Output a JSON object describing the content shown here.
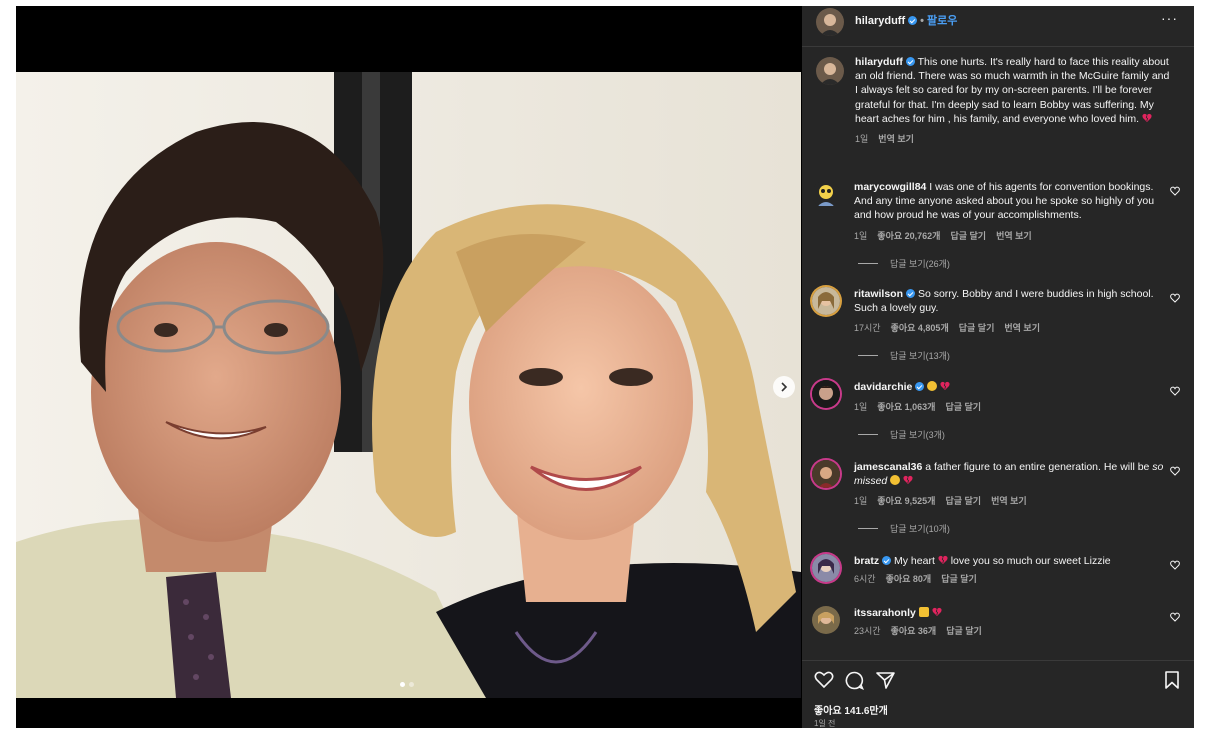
{
  "post": {
    "username": "hilaryduff",
    "follow_label": "팔로우",
    "more_label": "···",
    "caption": "This one hurts. It's really hard to face this reality about an old friend. There was so much warmth in the McGuire family and I always felt so cared for by my on-screen parents. I'll be forever grateful for that. I'm deeply sad to learn Bobby was suffering. My heart aches for him , his family, and everyone who loved him.",
    "caption_time": "1일",
    "caption_translate": "번역 보기"
  },
  "comments": [
    {
      "username": "marycowgill84",
      "text": "I was one of his agents for convention bookings. And any time anyone asked about you he spoke so highly of you and how proud he was of your accomplishments.",
      "time": "1일",
      "likes": "좋아요 20,762개",
      "reply": "답글 달기",
      "translate": "번역 보기",
      "view_replies": "답글 보기(26개)"
    },
    {
      "username": "ritawilson",
      "text": "So sorry. Bobby and I were buddies in high school. Such a lovely guy.",
      "time": "17시간",
      "likes": "좋아요 4,805개",
      "reply": "답글 달기",
      "translate": "번역 보기",
      "view_replies": "답글 보기(13개)"
    },
    {
      "username": "davidarchie",
      "text": "",
      "time": "1일",
      "likes": "좋아요 1,063개",
      "reply": "답글 달기",
      "view_replies": "답글 보기(3개)"
    },
    {
      "username": "jamescanal36",
      "text": "a father figure to an entire generation. He will be",
      "text_italic": "so missed",
      "time": "1일",
      "likes": "좋아요 9,525개",
      "reply": "답글 달기",
      "translate": "번역 보기",
      "view_replies": "답글 보기(10개)"
    },
    {
      "username": "bratz",
      "text_a": "My heart",
      "text_b": "love you so much our sweet Lizzie",
      "time": "6시간",
      "likes": "좋아요 80개",
      "reply": "답글 달기"
    },
    {
      "username": "itssarahonly",
      "time": "23시간",
      "likes": "좋아요 36개",
      "reply": "답글 달기"
    }
  ],
  "footer": {
    "likes": "좋아요 141.6만개",
    "time_ago": "1일 전"
  },
  "colors": {
    "panel_bg": "#262626",
    "link_blue": "#4a9ff5",
    "verified_blue": "#3897f0",
    "muted": "#a8a8a8",
    "broken_heart": "#e0245e"
  },
  "icons": [
    "verified-icon",
    "more-icon",
    "heart-icon",
    "comment-icon",
    "share-icon",
    "bookmark-icon",
    "chevron-right-icon",
    "broken-heart-emoji"
  ],
  "carousel": {
    "current_slide": 1,
    "total_slides": 2
  }
}
